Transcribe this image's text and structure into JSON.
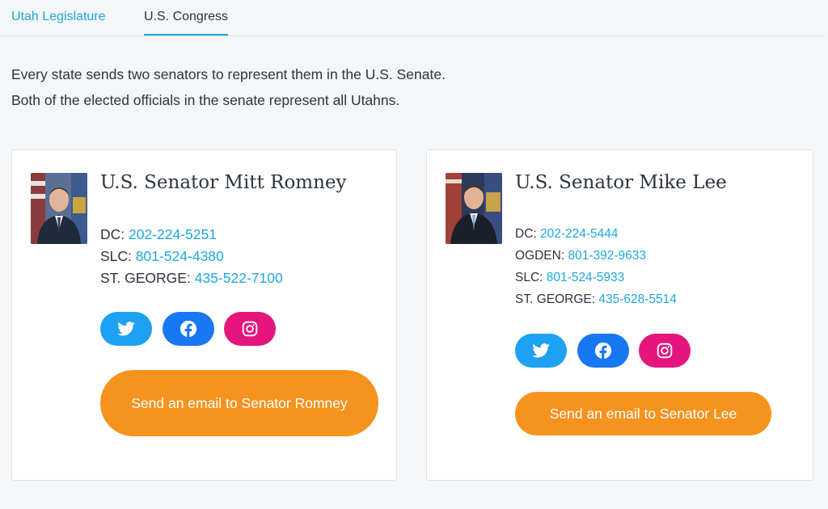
{
  "tabs": [
    {
      "label": "Utah Legislature",
      "active": false
    },
    {
      "label": "U.S. Congress",
      "active": true
    }
  ],
  "intro": {
    "line1": "Every state sends two senators to represent them in the U.S. Senate.",
    "line2": "Both of the elected officials in the senate represent all Utahns."
  },
  "senators": [
    {
      "name": "U.S. Senator Mitt Romney",
      "phones": [
        {
          "label": "DC: ",
          "number": "202-224-5251"
        },
        {
          "label": "SLC: ",
          "number": "801-524-4380"
        },
        {
          "label": "ST. GEORGE: ",
          "number": "435-522-7100"
        }
      ],
      "email_label": "Send an email to Senator Romney"
    },
    {
      "name": "U.S. Senator Mike Lee",
      "phones": [
        {
          "label": "DC: ",
          "number": "202-224-5444"
        },
        {
          "label": "OGDEN: ",
          "number": "801-392-9633"
        },
        {
          "label": "SLC: ",
          "number": "801-524-5933"
        },
        {
          "label": "ST. GEORGE: ",
          "number": "435-628-5514"
        }
      ],
      "email_label": "Send an email to Senator Lee"
    }
  ],
  "social_icons": [
    "twitter-icon",
    "facebook-icon",
    "instagram-icon"
  ],
  "colors": {
    "accent": "#1ea7dd",
    "twitter": "#1da1f2",
    "facebook": "#1877f2",
    "instagram": "#e4167d",
    "email_button": "#f6931f"
  }
}
